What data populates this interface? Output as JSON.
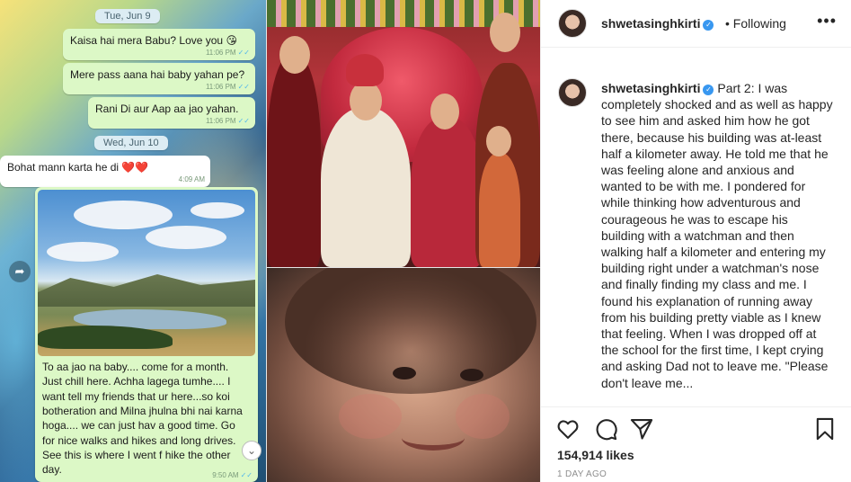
{
  "chat": {
    "dates": [
      "Tue, Jun 9",
      "Wed, Jun 10"
    ],
    "messages": [
      {
        "text": "Kaisa hai mera Babu? Love you 😘",
        "time": "11:06 PM"
      },
      {
        "text": "Mere pass aana hai baby yahan pe?",
        "time": "11:06 PM"
      },
      {
        "text": "Rani Di aur Aap aa jao yahan.",
        "time": "11:06 PM"
      },
      {
        "text": "Bohat mann karta he di ❤️❤️",
        "time": "4:09 AM"
      }
    ],
    "media_caption": "To aa jao na baby.... come for a month. Just chill here. Achha lagega tumhe.... I want tell my friends that ur here...so koi botheration and Milna jhulna bhi nai karna hoga.... we can just hav a good time. Go for nice walks and hikes and long drives. See this is where I went f hike the other day.",
    "media_time": "9:50 AM"
  },
  "post": {
    "username": "shwetasinghkirti",
    "follow_state": "Following",
    "more_label": "•••",
    "caption": "Part 2: I was completely shocked and as well as happy to see him and asked him how he got there, because his building was at-least half a kilometer away. He told me that he was feeling alone and anxious and wanted to be with me. I pondered for while thinking how adventurous and courageous he was to escape his building with a watchman and then walking half a kilometer and entering my building right under a watchman's nose and finally finding my class and me. I found his explanation of running away from his building pretty viable as I knew that feeling. When I was dropped off at the school for the first time, I kept crying and asking Dad not to leave me. \"Please don't leave me...",
    "likes": "154,914 likes",
    "timestamp": "1 DAY AGO"
  },
  "icons": {
    "verified": "verified-badge-icon",
    "like": "heart-icon",
    "comment": "comment-icon",
    "share": "paper-plane-icon",
    "save": "bookmark-icon",
    "forward": "forward-arrow-icon",
    "scroll": "chevron-down-icon"
  },
  "colors": {
    "verified_blue": "#3897f0",
    "bubble_out": "#dcf8c6",
    "bubble_in": "#ffffff",
    "text_primary": "#262626",
    "text_secondary": "#8e8e8e"
  }
}
